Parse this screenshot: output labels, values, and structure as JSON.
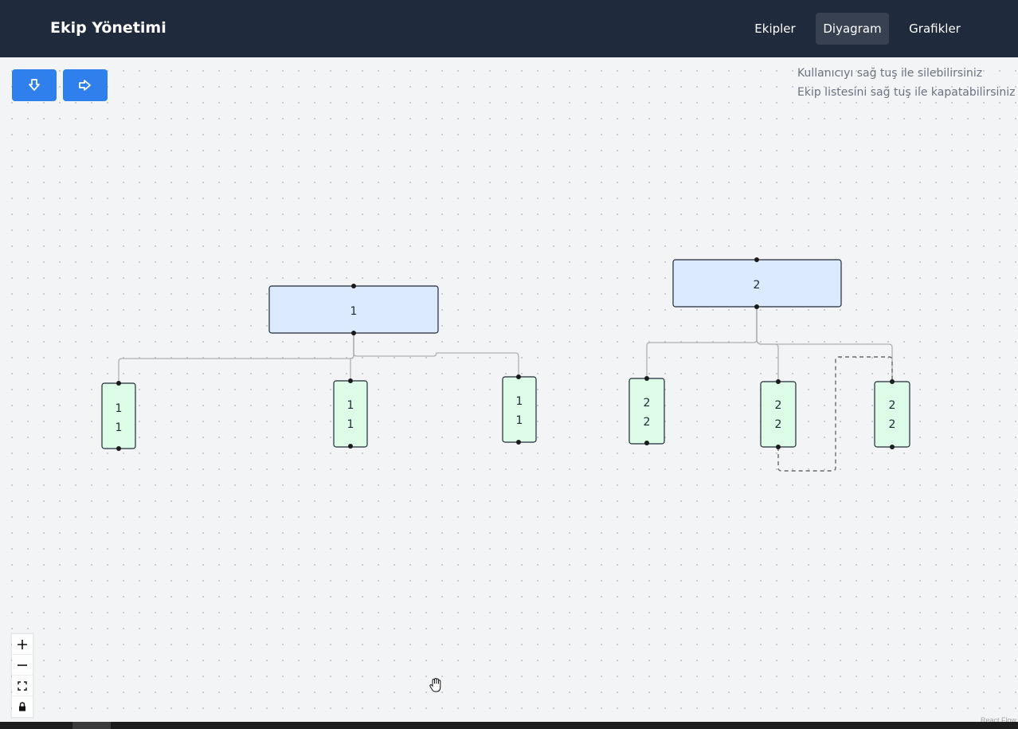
{
  "header": {
    "brand": "Ekip Yönetimi",
    "nav": [
      {
        "label": "Ekipler",
        "active": false
      },
      {
        "label": "Diyagram",
        "active": true
      },
      {
        "label": "Grafikler",
        "active": false
      }
    ]
  },
  "toolbar": {
    "buttons": [
      {
        "icon": "arrow-down-icon"
      },
      {
        "icon": "arrow-right-icon"
      }
    ]
  },
  "hints": [
    "Kullanıcıyı sağ tuş ile silebilirsiniz",
    "Ekip listesini sağ tuş ile kapatabilirsiniz"
  ],
  "diagram": {
    "teams": [
      {
        "label": "1",
        "members": [
          {
            "lines": [
              "1",
              "1"
            ]
          },
          {
            "lines": [
              "1",
              "1"
            ]
          },
          {
            "lines": [
              "1",
              "1"
            ]
          }
        ]
      },
      {
        "label": "2",
        "members": [
          {
            "lines": [
              "2",
              "2"
            ]
          },
          {
            "lines": [
              "2",
              "2"
            ]
          },
          {
            "lines": [
              "2",
              "2"
            ]
          }
        ]
      }
    ],
    "colors": {
      "team_fill": "#dbeafe",
      "member_fill": "#dcfce7",
      "node_border": "#1f2937",
      "edge": "#b0b0b0",
      "dashed_edge": "#6b6b6b"
    }
  },
  "controls": [
    {
      "icon": "zoom-in-icon"
    },
    {
      "icon": "zoom-out-icon"
    },
    {
      "icon": "fit-view-icon"
    },
    {
      "icon": "lock-icon"
    }
  ],
  "attribution": "React Flow",
  "accent": "#2f80ed"
}
